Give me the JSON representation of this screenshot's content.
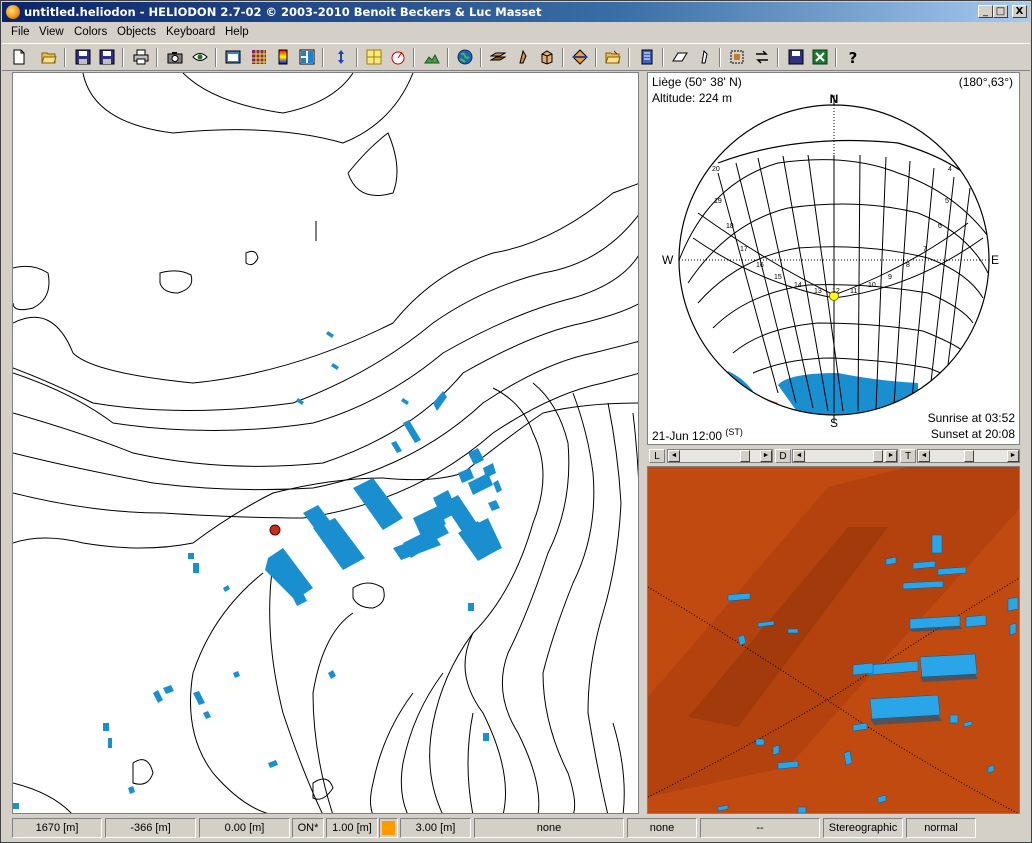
{
  "window": {
    "title": "untitled.heliodon  - HELIODON 2.7-02 © 2003-2010 Benoit Beckers & Luc Masset",
    "minimize": "_",
    "maximize": "□",
    "close": "X"
  },
  "menu": [
    "File",
    "View",
    "Colors",
    "Objects",
    "Keyboard",
    "Help"
  ],
  "toolbar_icons": [
    "new-icon",
    "open-icon",
    "save-icon",
    "save-as-icon",
    "print-icon",
    "camera-icon",
    "eye-icon",
    "window-icon",
    "grid-color-icon",
    "color-scale-icon",
    "tiles-icon",
    "swap-icon",
    "layout-icon",
    "sundial-icon",
    "terrain-icon",
    "globe-icon",
    "layers-icon",
    "plane-icon",
    "box-icon",
    "diamond-icon",
    "folder-icon",
    "page-icon",
    "shear-icon",
    "slant-icon",
    "select-icon",
    "arrows-icon",
    "disk-icon",
    "excel-icon",
    "help-icon"
  ],
  "sun": {
    "location": "Liège (50° 38' N)",
    "altitude": "Altitude: 224 m",
    "angles": "(180°,63°)",
    "date_time": "21-Jun 12:00",
    "time_suffix": "(ST)",
    "sunrise": "Sunrise at 03:52",
    "sunset": "Sunset at 20:08",
    "north": "N",
    "south": "S",
    "east": "E",
    "west": "W",
    "hours": [
      "4",
      "5",
      "6",
      "7",
      "8",
      "9",
      "10",
      "11",
      "12",
      "13",
      "14",
      "15",
      "16",
      "17",
      "18",
      "19",
      "20"
    ]
  },
  "sliders": {
    "l_label": "L",
    "d_label": "D",
    "t_label": "T"
  },
  "status": {
    "x": "1670 [m]",
    "y": "-366 [m]",
    "z": "0.00 [m]",
    "on": "ON*",
    "scale": "1.00 [m]",
    "height": "3.00 [m]",
    "field1": "none",
    "field2": "none",
    "field3": "--",
    "projection": "Stereographic",
    "mode": "normal",
    "swatch_color": "#ff9900"
  },
  "colors": {
    "building": "#1a8fd0",
    "terrain_3d": "#c14a10",
    "observer_marker": "#c0301a"
  }
}
